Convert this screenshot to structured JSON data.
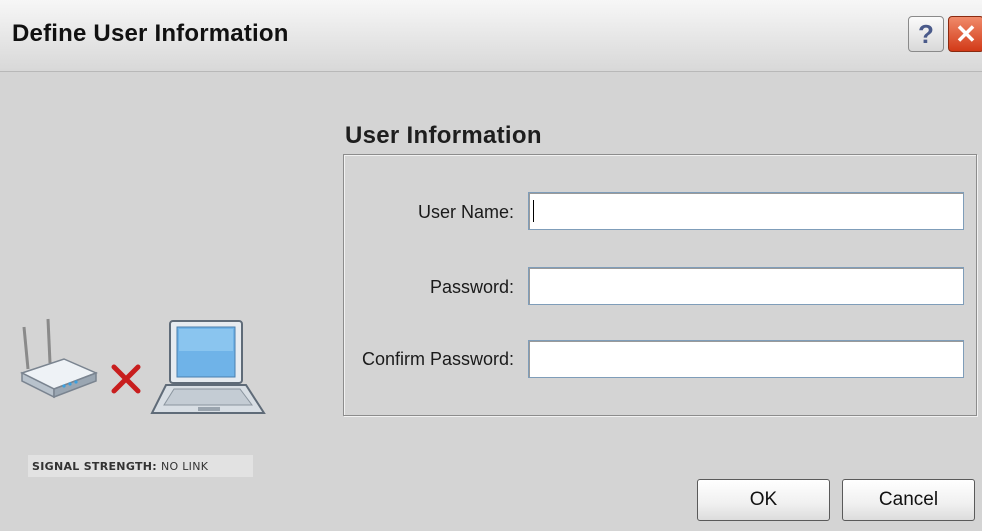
{
  "window": {
    "title": "Define User Information",
    "help_glyph": "?",
    "close_glyph": "✕"
  },
  "section": {
    "title": "User Information"
  },
  "form": {
    "fields": [
      {
        "label": "User Name:",
        "value": ""
      },
      {
        "label": "Password:",
        "value": ""
      },
      {
        "label": "Confirm Password:",
        "value": ""
      }
    ]
  },
  "status": {
    "signal_label": "SIGNAL STRENGTH:",
    "signal_value": "NO LINK"
  },
  "buttons": {
    "ok_label": "OK",
    "cancel_label": "Cancel"
  },
  "icons": {
    "router": "wireless-router-icon",
    "disconnected": "red-x-icon",
    "laptop": "laptop-icon"
  },
  "colors": {
    "dialog_bg": "#d4d4d4",
    "close_red": "#d23a18",
    "link_status_x": "#c81e1e",
    "laptop_blue": "#6fb3e8"
  }
}
